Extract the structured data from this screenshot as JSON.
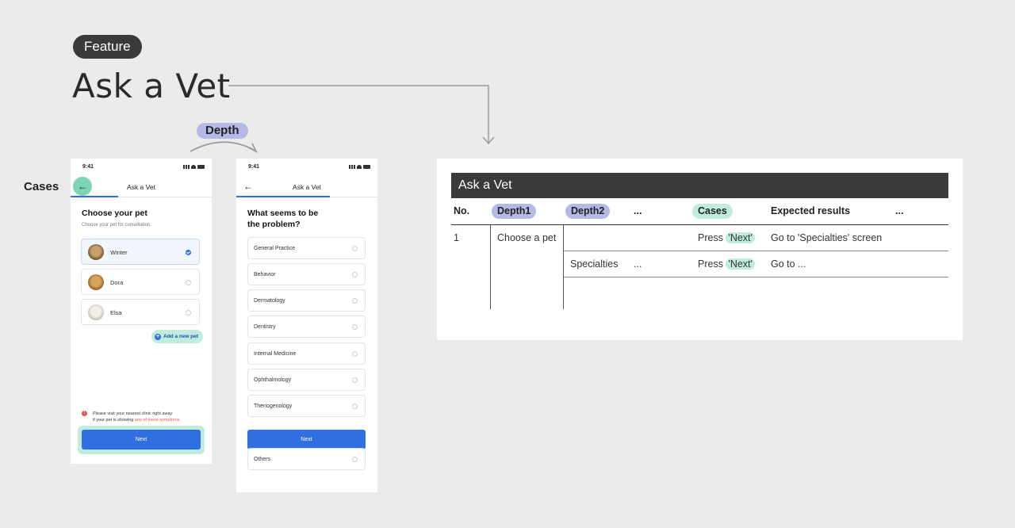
{
  "header": {
    "feature_label": "Feature",
    "title": "Ask a Vet"
  },
  "labels": {
    "depth": "Depth",
    "cases": "Cases"
  },
  "phone1": {
    "time": "9:41",
    "title": "Ask a Vet",
    "heading": "Choose your pet",
    "subheading": "Choose your pet for consultation.",
    "pets": [
      {
        "name": "Winter",
        "selected": true
      },
      {
        "name": "Dora",
        "selected": false
      },
      {
        "name": "Elsa",
        "selected": false
      }
    ],
    "add_pet": "Add a new pet",
    "notice_line1": "Please visit your nearest clinic right away",
    "notice_line2_prefix": "if your pet is showing ",
    "notice_link": "any of these symptoms",
    "next": "Next"
  },
  "phone2": {
    "time": "9:41",
    "title": "Ask a Vet",
    "heading_line1": "What seems to be",
    "heading_line2": "the problem?",
    "options": [
      "General Practice",
      "Behavior",
      "Dermatology",
      "Dentistry",
      "Internal Medicine",
      "Ophthalmology",
      "Theriogenology"
    ],
    "next": "Next",
    "last_option": "Others"
  },
  "table": {
    "title": "Ask a Vet",
    "columns": {
      "no": "No.",
      "depth1": "Depth1",
      "depth2": "Depth2",
      "ellipsis1": "...",
      "cases": "Cases",
      "expected": "Expected results",
      "ellipsis2": "..."
    },
    "rows": [
      {
        "no": "1",
        "depth1": "Choose a pet",
        "depth2": "",
        "ellipsis": "",
        "cases_prefix": "Press ",
        "cases_quote": "'Next'",
        "expected": "Go to 'Specialties' screen"
      },
      {
        "no": "",
        "depth1": "",
        "depth2": "Specialties",
        "ellipsis": "...",
        "cases_prefix": "Press ",
        "cases_quote": "'Next'",
        "expected": "Go to ..."
      }
    ]
  },
  "colors": {
    "accent_blue": "#2f6fe0",
    "depth_purple": "#b5b9e6",
    "cases_green": "#bfecdc",
    "dark": "#3a3a3a"
  }
}
